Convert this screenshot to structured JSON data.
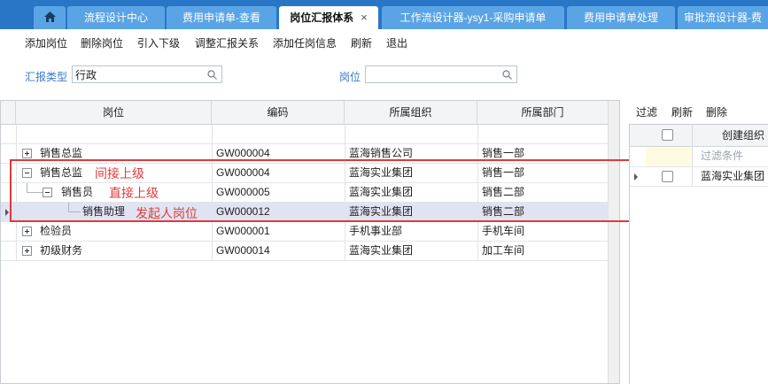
{
  "tabs": [
    {
      "label": "",
      "icon": "home-icon"
    },
    {
      "label": "流程设计中心"
    },
    {
      "label": "费用申请单-查看"
    },
    {
      "label": "岗位汇报体系",
      "active": true,
      "close": "×"
    },
    {
      "label": "工作流设计器-ysy1-采购申请单"
    },
    {
      "label": "费用申请单处理"
    },
    {
      "label": "审批流设计器-费"
    }
  ],
  "toolbar": [
    "添加岗位",
    "删除岗位",
    "引入下级",
    "调整汇报关系",
    "添加任岗信息",
    "刷新",
    "退出"
  ],
  "filters": {
    "report_type_label": "汇报类型",
    "report_type_value": "行政",
    "position_label": "岗位",
    "position_value": ""
  },
  "grid": {
    "columns": [
      "岗位",
      "编码",
      "所属组织",
      "所属部门"
    ],
    "rows": [
      {
        "position": "",
        "code": "",
        "org": "",
        "dept": ""
      },
      {
        "position": "销售总监",
        "code": "GW000004",
        "org": "蓝海销售公司",
        "dept": "销售一部"
      },
      {
        "position": "销售总监",
        "code": "GW000004",
        "org": "蓝海实业集团",
        "dept": "销售一部"
      },
      {
        "position": "销售员",
        "code": "GW000005",
        "org": "蓝海实业集团",
        "dept": "销售二部"
      },
      {
        "position": "销售助理",
        "code": "GW000012",
        "org": "蓝海实业集团",
        "dept": "销售二部"
      },
      {
        "position": "检验员",
        "code": "GW000001",
        "org": "手机事业部",
        "dept": "手机车间"
      },
      {
        "position": "初级财务",
        "code": "GW000014",
        "org": "蓝海实业集团",
        "dept": "加工车间"
      }
    ]
  },
  "annotations": {
    "indirect": "间接上级",
    "direct": "直接上级",
    "initiator": "发起人岗位"
  },
  "right_panel": {
    "toolbar": [
      "过滤",
      "刷新",
      "删除"
    ],
    "column": "创建组织",
    "filter_placeholder": "过滤条件",
    "rows": [
      "蓝海实业集团"
    ]
  },
  "colors": {
    "tabbar": "#2a76c6",
    "tab": "#5aa4e6",
    "annotation": "#e23b3b",
    "selected_row": "#dfe3f2"
  }
}
